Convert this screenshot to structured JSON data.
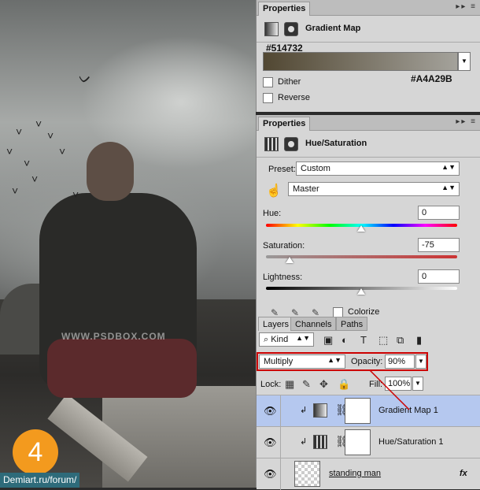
{
  "photo": {
    "watermark": "WWW.PSDBOX.COM",
    "step_number": "4",
    "site_link": "Demiart.ru/forum/"
  },
  "gradient_panel": {
    "tab": "Properties",
    "title": "Gradient Map",
    "color_left": "#514732",
    "color_right": "#A4A29B",
    "dither_label": "Dither",
    "reverse_label": "Reverse"
  },
  "hue_panel": {
    "tab": "Properties",
    "title": "Hue/Saturation",
    "preset_label": "Preset:",
    "preset_value": "Custom",
    "channel_value": "Master",
    "hue_label": "Hue:",
    "hue_value": "0",
    "saturation_label": "Saturation:",
    "saturation_value": "-75",
    "lightness_label": "Lightness:",
    "lightness_value": "0",
    "colorize_label": "Colorize"
  },
  "layers_panel": {
    "tabs": [
      "Layers",
      "Channels",
      "Paths"
    ],
    "kind_value": "Kind",
    "blend_mode": "Multiply",
    "opacity_label": "Opacity:",
    "opacity_value": "90%",
    "lock_label": "Lock:",
    "fill_label": "Fill:",
    "fill_value": "100%",
    "layers": [
      {
        "name": "Gradient Map 1",
        "selected": true
      },
      {
        "name": "Hue/Saturation 1",
        "selected": false
      },
      {
        "name": "standing man",
        "selected": false,
        "fx": "fx"
      }
    ]
  }
}
